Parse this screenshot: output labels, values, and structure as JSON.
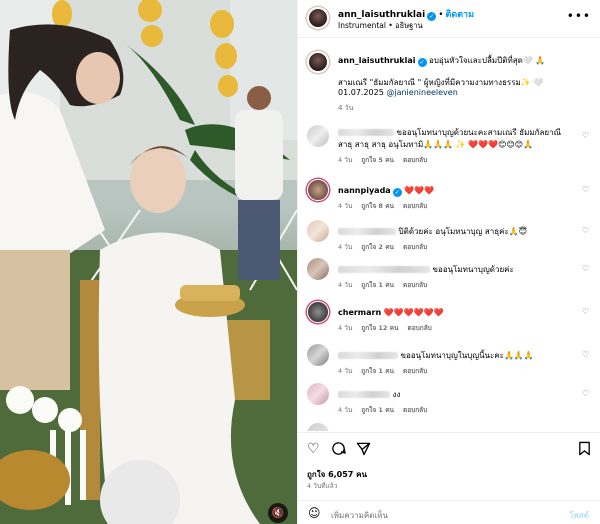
{
  "post": {
    "username": "ann_laisuthruklai",
    "follow_label": "ติดตาม",
    "audio": "Instrumental • อธิษฐาน",
    "more_icon": "more-horizontal-icon"
  },
  "caption": {
    "username": "ann_laisuthruklai",
    "text_line1": "อบอุ่นหัวใจและปลื้มปีติที่สุด🤍 🙏",
    "text_line2": "สามเณรี \"ธัมมกัลยาณี \" ผู้หญิงที่มีความงามทางธรรม✨ 🤍",
    "date_text": "01.07.2025",
    "mention": "@janienineeleven",
    "time": "4 วัน"
  },
  "comments": [
    {
      "username": "",
      "text": "ขออนุโมทนาบุญด้วยนะคะสามเณรี ธัมมกัลยาณี สาธุ สาธุ สาธุ อนุโมทามิ🙏🙏🙏 ✨ ❤️❤️❤️😊😊😊🙏",
      "time": "4 วัน",
      "likes": "ถูกใจ 5 คน",
      "reply": "ตอบกลับ"
    },
    {
      "username": "nannpiyada",
      "text": "❤️❤️❤️",
      "time": "4 วัน",
      "likes": "ถูกใจ 8 คน",
      "reply": "ตอบกลับ"
    },
    {
      "username": "",
      "text": "ปิติด้วยค่ะ อนุโมทนาบุญ สาธุค่ะ🙏😇",
      "time": "4 วัน",
      "likes": "ถูกใจ 2 คน",
      "reply": "ตอบกลับ"
    },
    {
      "username": "",
      "text": "ขออนุโมทนาบุญด้วยค่ะ",
      "time": "4 วัน",
      "likes": "ถูกใจ 1 คน",
      "reply": "ตอบกลับ"
    },
    {
      "username": "chermarn",
      "text": "❤️❤️❤️❤️❤️❤️",
      "time": "4 วัน",
      "likes": "ถูกใจ 12 คน",
      "reply": "ตอบกลับ"
    },
    {
      "username": "",
      "text": "ขออนุโมทนาบุญในบุญนี้นะคะ🙏🙏🙏",
      "time": "4 วัน",
      "likes": "ถูกใจ 1 คน",
      "reply": "ตอบกลับ"
    },
    {
      "username": "",
      "text": "งง",
      "time": "4 วัน",
      "likes": "ถูกใจ 1 คน",
      "reply": "ตอบกลับ"
    }
  ],
  "footer": {
    "likes": "ถูกใจ 6,057 คน",
    "ago": "4 วันที่แล้ว",
    "placeholder": "เพิ่มความคิดเห็น",
    "post_label": "โพสต์"
  },
  "colors": {
    "accent": "#0095f6",
    "muted": "#737373"
  }
}
